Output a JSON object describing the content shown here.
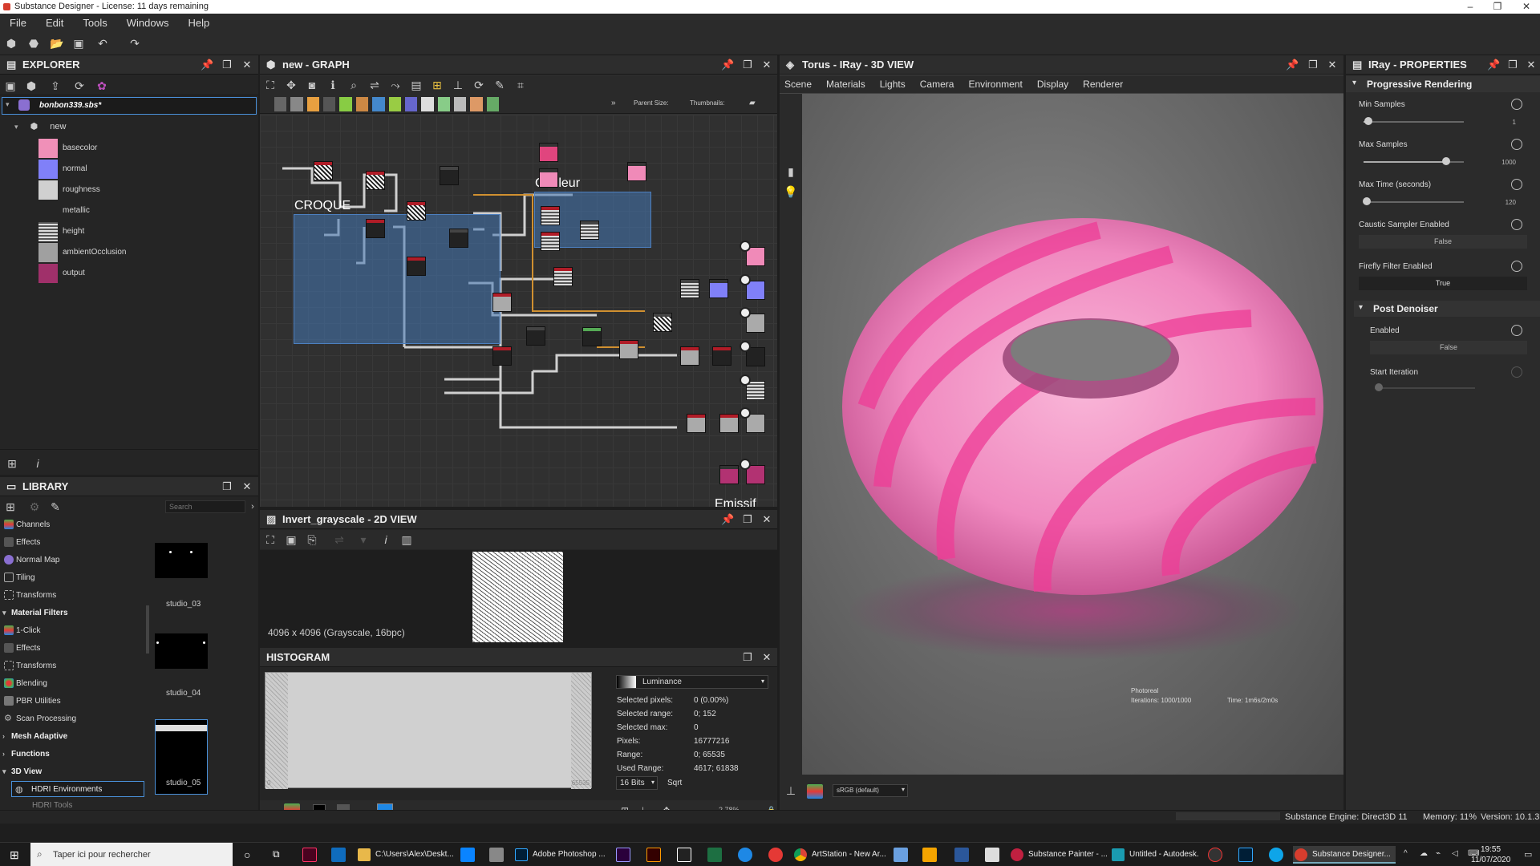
{
  "window": {
    "title": "Substance Designer - License: 11 days remaining",
    "controls": [
      "–",
      "❐",
      "✕"
    ]
  },
  "menu": [
    "File",
    "Edit",
    "Tools",
    "Windows",
    "Help"
  ],
  "explorer": {
    "title": "EXPLORER",
    "package": "bonbon339.sbs*",
    "graph": "new",
    "outputs": [
      {
        "label": "basecolor",
        "color": "#f090b8"
      },
      {
        "label": "normal",
        "color": "#8080f8"
      },
      {
        "label": "roughness",
        "color": "#d0d0d0"
      },
      {
        "label": "metallic",
        "color": "#252525"
      },
      {
        "label": "height",
        "color": "stripe"
      },
      {
        "label": "ambientOcclusion",
        "color": "#a0a0a0"
      },
      {
        "label": "output",
        "color": "#a0306a"
      }
    ]
  },
  "graph": {
    "title": "new - GRAPH",
    "parent_size_label": "Parent Size:",
    "thumbnails_label": "Thumbnails:",
    "frames": [
      "CROQUE",
      "Couleur",
      "Emissif"
    ]
  },
  "view3d": {
    "title": "Torus - IRay - 3D VIEW",
    "menu": [
      "Scene",
      "Materials",
      "Lights",
      "Camera",
      "Environment",
      "Display",
      "Renderer"
    ],
    "render_mode": "Photoreal",
    "iterations": "Iterations: 1000/1000",
    "time": "Time: 1m6s/2m0s",
    "colorspace": "sRGB (default)"
  },
  "properties": {
    "title": "IRay - PROPERTIES",
    "section1": "Progressive Rendering",
    "min_samples_label": "Min Samples",
    "min_samples_value": "1",
    "min_samples_fraction": 0.05,
    "max_samples_label": "Max Samples",
    "max_samples_value": "1000",
    "max_samples_fraction": 0.82,
    "max_time_label": "Max Time (seconds)",
    "max_time_value": "120",
    "max_time_fraction": 0.03,
    "caustic_label": "Caustic Sampler Enabled",
    "caustic_value": "False",
    "firefly_label": "Firefly Filter Enabled",
    "firefly_value": "True",
    "section2": "Post Denoiser",
    "enabled_label": "Enabled",
    "enabled_value": "False",
    "start_iteration_label": "Start Iteration"
  },
  "library": {
    "title": "LIBRARY",
    "search_placeholder": "Search",
    "items_top": [
      "Channels",
      "Effects",
      "Normal Map",
      "Tiling",
      "Transforms"
    ],
    "material_filters": "Material Filters",
    "material_items": [
      "1-Click",
      "Effects",
      "Transforms",
      "Blending",
      "PBR Utilities",
      "Scan Processing"
    ],
    "mesh_adaptive": "Mesh Adaptive",
    "functions": "Functions",
    "view3d": "3D View",
    "hdri": "HDRI Environments",
    "hdri_tools": "HDRI Tools",
    "thumbs": [
      "studio_03",
      "studio_04",
      "studio_05"
    ]
  },
  "view2d": {
    "title": "Invert_grayscale - 2D VIEW",
    "info": "4096 x 4096 (Grayscale, 16bpc)",
    "zoom": "2.78%"
  },
  "histogram": {
    "title": "HISTOGRAM",
    "channel": "Luminance",
    "axis_min": "0",
    "axis_max": "65535",
    "stats": [
      {
        "label": "Selected pixels:",
        "value": "0 (0.00%)"
      },
      {
        "label": "Selected range:",
        "value": "0; 152"
      },
      {
        "label": "Selected max:",
        "value": "0"
      },
      {
        "label": "Pixels:",
        "value": "16777216"
      },
      {
        "label": "Range:",
        "value": "0; 65535"
      },
      {
        "label": "Used Range:",
        "value": "4617; 61838"
      }
    ],
    "bits": "16 Bits",
    "mode": "Sqrt"
  },
  "statusbar": {
    "engine": "Substance Engine: Direct3D 11",
    "memory": "Memory: 11%",
    "version": "Version: 10.1.3"
  },
  "taskbar": {
    "search": "Taper ici pour rechercher",
    "apps": [
      "C:\\Users\\Alex\\Deskt...",
      "Adobe Photoshop ...",
      "ArtStation - New Ar...",
      "Substance Painter - ...",
      "Untitled - Autodesk...",
      "Substance Designer..."
    ],
    "time": "19:55",
    "date": "11/07/2020"
  }
}
